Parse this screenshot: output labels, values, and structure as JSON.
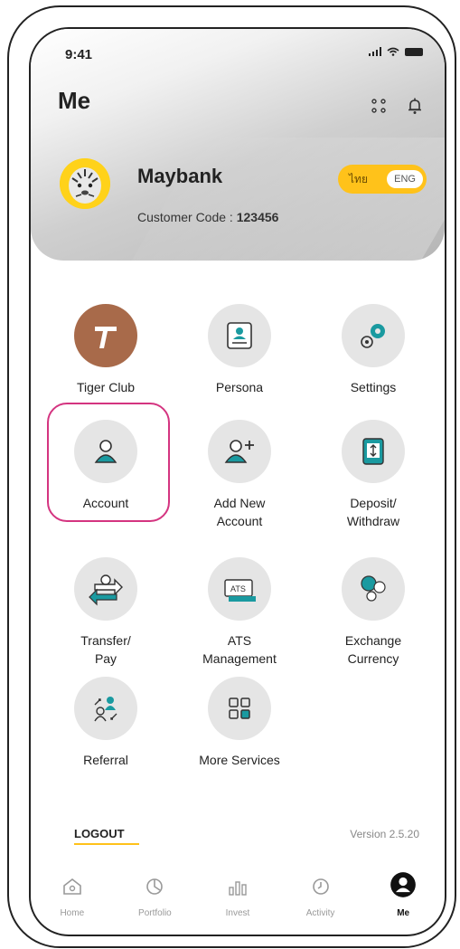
{
  "status_bar": {
    "time": "9:41"
  },
  "page": {
    "title": "Me"
  },
  "profile": {
    "name": "Maybank",
    "customer_code_label": "Customer Code :",
    "customer_code": "123456"
  },
  "language": {
    "thai": "ไทย",
    "english": "ENG",
    "selected": "ENG"
  },
  "menu": [
    {
      "label": "Tiger Club",
      "icon": "tiger-club-icon"
    },
    {
      "label": "Persona",
      "icon": "persona-icon"
    },
    {
      "label": "Settings",
      "icon": "settings-icon"
    },
    {
      "label": "Account",
      "icon": "account-icon"
    },
    {
      "label": "Add New Account",
      "icon": "add-account-icon"
    },
    {
      "label": "Deposit/ Withdraw",
      "icon": "deposit-withdraw-icon"
    },
    {
      "label": "Transfer/ Pay",
      "icon": "transfer-pay-icon"
    },
    {
      "label": "ATS Management",
      "icon": "ats-icon"
    },
    {
      "label": "Exchange Currency",
      "icon": "exchange-currency-icon"
    },
    {
      "label": "Referral",
      "icon": "referral-icon"
    },
    {
      "label": "More Services",
      "icon": "more-services-icon"
    }
  ],
  "footer": {
    "logout": "LOGOUT",
    "version": "Version 2.5.20"
  },
  "tabs": [
    {
      "label": "Home",
      "icon": "home-icon"
    },
    {
      "label": "Portfolio",
      "icon": "portfolio-icon"
    },
    {
      "label": "Invest",
      "icon": "invest-icon"
    },
    {
      "label": "Activity",
      "icon": "activity-icon"
    },
    {
      "label": "Me",
      "icon": "me-icon",
      "active": true
    }
  ],
  "colors": {
    "accent": "#ffc21a",
    "highlight": "#d43480",
    "teal": "#1a9aa0"
  }
}
